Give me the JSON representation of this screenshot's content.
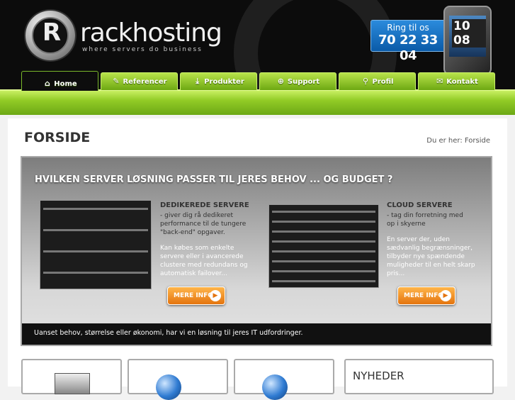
{
  "header": {
    "brand": "rackhosting",
    "tagline": "where servers do business",
    "call_label": "Ring til os",
    "call_number": "70 22 33 04",
    "phone_clock": "10 08"
  },
  "nav": {
    "tabs": [
      {
        "label": "Home",
        "icon": "home-icon"
      },
      {
        "label": "Referencer",
        "icon": "pencil-icon"
      },
      {
        "label": "Produkter",
        "icon": "download-icon"
      },
      {
        "label": "Support",
        "icon": "plus-icon"
      },
      {
        "label": "Profil",
        "icon": "search-icon"
      },
      {
        "label": "Kontakt",
        "icon": "mail-icon"
      }
    ]
  },
  "page": {
    "title": "FORSIDE",
    "breadcrumb": "Du er her: Forside"
  },
  "banner": {
    "headline": "HVILKEN SERVER LØSNING PASSER TIL JERES BEHOV ... OG BUDGET ?",
    "dedicated": {
      "title": "DEDIKEREDE SERVERE",
      "subtitle": "- giver dig rå dedikeret performance til de tungere \"back-end\" opgaver.",
      "body": "Kan købes som enkelte servere eller i avancerede clustere med redundans og automatisk failover...",
      "button": "MERE INFO"
    },
    "cloud": {
      "title": "CLOUD SERVERE",
      "subtitle": "- tag din forretning med op i skyerne",
      "body": "En server der, uden sædvanlig begrænsninger, tilbyder nye spændende muligheder til en helt skarp pris...",
      "button": "MERE INFO"
    },
    "footer": "Uanset behov, størrelse eller økonomi, har vi en løsning til jeres IT udfordringer."
  },
  "news": {
    "title": "NYHEDER"
  },
  "colors": {
    "accent_green": "#8cc63f",
    "orange": "#f39419",
    "blue": "#1a6fc4"
  }
}
